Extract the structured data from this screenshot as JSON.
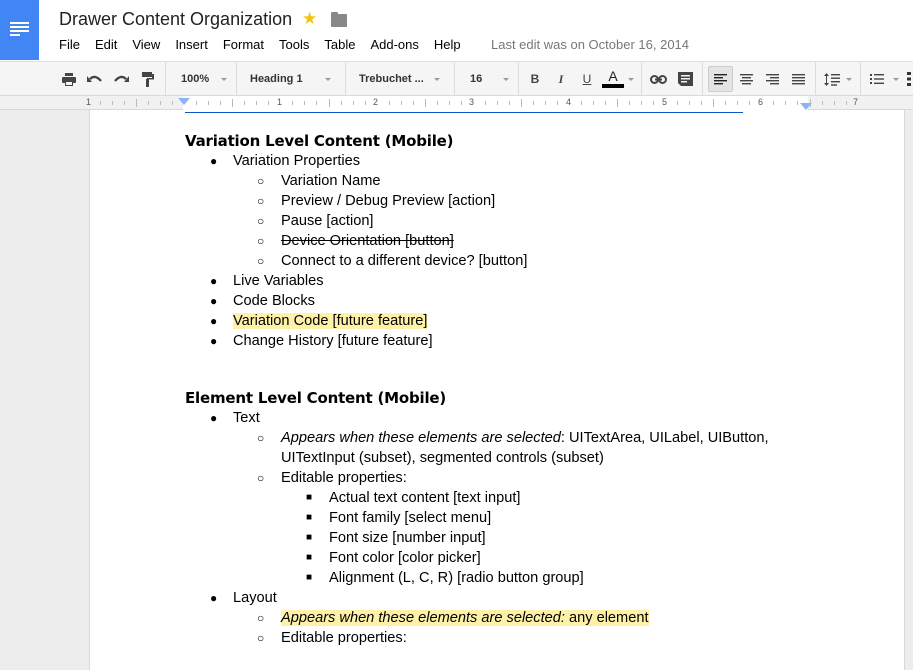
{
  "header": {
    "title": "Drawer Content Organization",
    "last_edit": "Last edit was on October 16, 2014",
    "menu": [
      "File",
      "Edit",
      "View",
      "Insert",
      "Format",
      "Tools",
      "Table",
      "Add-ons",
      "Help"
    ]
  },
  "toolbar": {
    "zoom": "100%",
    "style": "Heading 1",
    "font": "Trebuchet ...",
    "size": "16",
    "bold": "B",
    "italic": "I",
    "underline": "U",
    "text_color": "A",
    "text_color_value": "#000000"
  },
  "ruler": {
    "labels": [
      "1",
      "1",
      "2",
      "3",
      "4",
      "5",
      "6",
      "7"
    ]
  },
  "document": {
    "section1": {
      "heading": "Variation Level Content (Mobile)",
      "item_properties": "Variation Properties",
      "sub": [
        "Variation Name",
        "Preview / Debug Preview [action]",
        "Pause [action]",
        "Device Orientation [button]",
        "Connect to a different device? [button]"
      ],
      "items": [
        "Live Variables",
        "Code Blocks",
        "Variation Code [future feature]",
        "Change History [future feature]"
      ]
    },
    "section2": {
      "heading": "Element Level Content (Mobile)",
      "text_item": "Text",
      "text_appears_italic": "Appears when these elements are selected",
      "text_appears_rest": ": UITextArea, UILabel, UIButton,",
      "text_appears_line2": "UITextInput (subset), segmented controls (subset)",
      "editable": "Editable properties:",
      "text_props": [
        "Actual text content [text input]",
        "Font family [select menu]",
        "Font size [number input]",
        "Font color [color picker]",
        "Alignment (L, C, R) [radio button group]"
      ],
      "layout_item": "Layout",
      "layout_appears_italic": "Appears when these elements are selected:",
      "layout_appears_rest": " any element",
      "layout_editable": "Editable properties:"
    },
    "bullets": {
      "l1": "●",
      "l2": "○",
      "l3": "■"
    }
  }
}
